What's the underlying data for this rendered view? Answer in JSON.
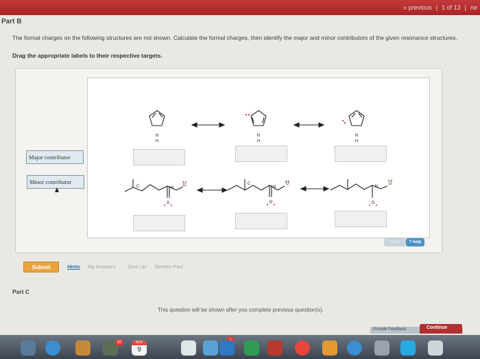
{
  "header": {
    "previous_label": "« previous",
    "separator": "|",
    "counter": "1 of 13",
    "next_label": "ne"
  },
  "part_b": {
    "title": "Part B",
    "question": "The formal charges on the following structures are not shown. Calculate the formal charges, then identify the major and minor contributors of the given resonance structures.",
    "instruction": "Drag the appropriate labels to their respective targets."
  },
  "labels": [
    {
      "text": "Major contributor"
    },
    {
      "text": "Minor contributor"
    }
  ],
  "molecule_text": {
    "n": "N",
    "h": "H",
    "c": "C",
    "o": "O"
  },
  "controls": {
    "reset": "reset",
    "help": "? help"
  },
  "actions": {
    "submit": "Submit",
    "hints": "Hints",
    "my_answers": "My Answers",
    "give_up": "Give Up",
    "review_part": "Review Part"
  },
  "part_c": {
    "title": "Part C",
    "message": "This question will be shown after you complete previous question(s)."
  },
  "footer": {
    "provide_feedback": "Provide Feedback",
    "continue": "Continue"
  },
  "dock": {
    "calendar_month": "NOV",
    "calendar_day": "9",
    "badge_count_a": "10",
    "badge_count_b": "1"
  }
}
